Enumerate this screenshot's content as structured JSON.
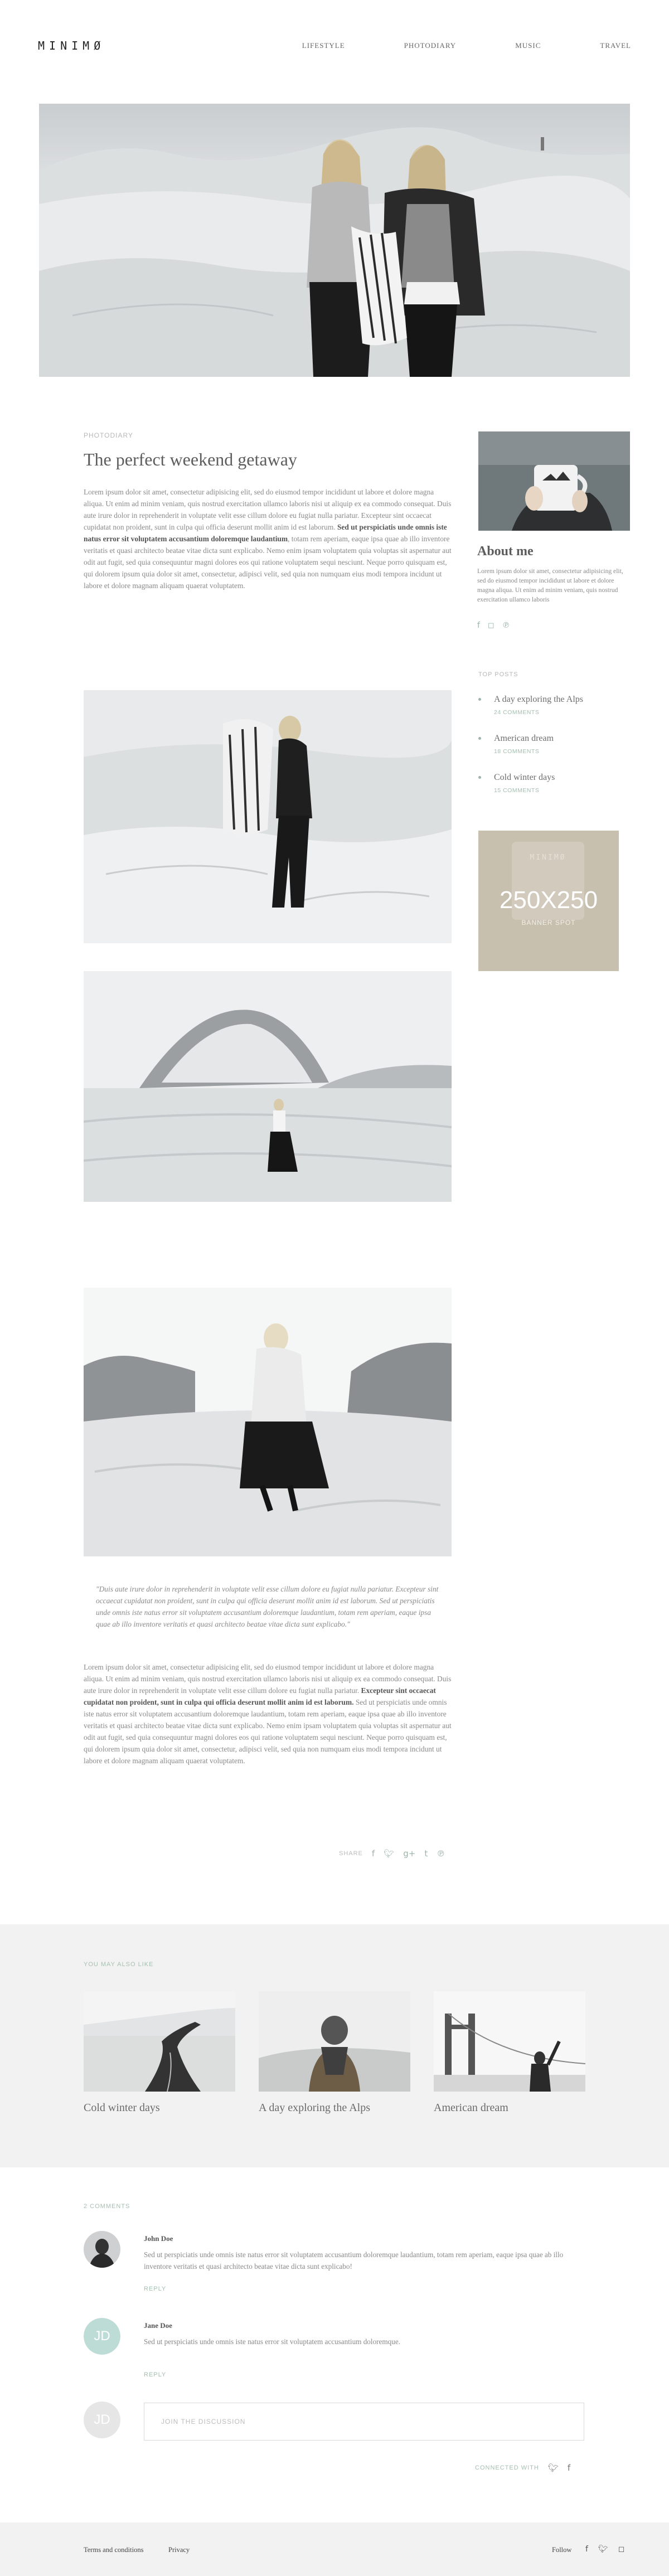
{
  "brand": {
    "logo": "MINIMØ"
  },
  "nav": {
    "items": [
      "LIFESTYLE",
      "PHOTODIARY",
      "MUSIC",
      "TRAVEL"
    ]
  },
  "article": {
    "category": "PHOTODIARY",
    "title": "The perfect weekend getaway",
    "intro_a": "Lorem ipsum dolor sit amet, consectetur adipisicing elit, sed do eiusmod tempor incididunt ut labore et dolore magna aliqua. Ut enim ad minim veniam, quis nostrud exercitation ullamco laboris nisi ut aliquip ex ea commodo consequat. Duis aute irure dolor in reprehenderit in voluptate velit esse cillum dolore eu fugiat nulla pariatur. Excepteur sint occaecat cupidatat non proident, sunt in culpa qui officia deserunt mollit anim id est laborum. ",
    "intro_bold": "Sed ut perspiciatis unde omnis iste natus error sit voluptatem accusantium doloremque laudantium",
    "intro_b": ", totam rem aperiam, eaque ipsa quae ab illo inventore veritatis et quasi architecto beatae vitae dicta sunt explicabo. Nemo enim ipsam voluptatem quia voluptas sit aspernatur aut odit aut fugit, sed quia consequuntur magni dolores eos qui ratione voluptatem sequi nesciunt. Neque porro quisquam est, qui dolorem ipsum quia dolor sit amet, consectetur, adipisci velit, sed quia non numquam eius modi tempora incidunt ut labore et dolore magnam aliquam quaerat voluptatem.",
    "quote": "\"Duis aute irure dolor in reprehenderit in voluptate velit esse cillum dolore eu fugiat nulla pariatur. Excepteur sint occaecat cupidatat non proident, sunt in culpa qui officia deserunt mollit anim id est laborum. Sed ut perspiciatis unde omnis iste natus error sit voluptatem accusantium doloremque laudantium, totam rem aperiam, eaque ipsa quae ab illo inventore veritatis et quasi architecto beatae vitae dicta sunt explicabo.\"",
    "outro_a": "Lorem ipsum dolor sit amet, consectetur adipisicing elit, sed do eiusmod tempor incididunt ut labore et dolore magna aliqua. Ut enim ad minim veniam, quis nostrud exercitation ullamco laboris nisi ut aliquip ex ea commodo consequat. Duis aute irure dolor in reprehenderit in voluptate velit esse cillum dolore eu fugiat nulla pariatur. ",
    "outro_bold": "Excepteur sint occaecat cupidatat non proident, sunt in culpa qui officia deserunt mollit anim id est laborum.",
    "outro_b": " Sed ut perspiciatis unde omnis iste natus error sit voluptatem accusantium doloremque laudantium, totam rem aperiam, eaque ipsa quae ab illo inventore veritatis et quasi architecto beatae vitae dicta sunt explicabo. Nemo enim ipsam voluptatem quia voluptas sit aspernatur aut odit aut fugit, sed quia consequuntur magni dolores eos qui ratione voluptatem sequi nesciunt. Neque porro quisquam est, qui dolorem ipsum quia dolor sit amet, consectetur, adipisci velit, sed quia non numquam eius modi tempora incidunt ut labore et dolore magnam aliquam quaerat voluptatem.",
    "share_label": "SHARE",
    "share_icons": [
      "facebook-icon",
      "twitter-icon",
      "google-plus-icon",
      "tumblr-icon",
      "pinterest-icon"
    ]
  },
  "sidebar": {
    "about_title": "About me",
    "about_text": "Lorem ipsum dolor sit amet, consectetur adipisicing elit, sed do eiusmod tempor incididunt ut labore et dolore magna aliqua. Ut enim ad minim veniam, quis nostrud exercitation ullamco laboris",
    "about_social": [
      "facebook-icon",
      "instagram-icon",
      "pinterest-icon"
    ],
    "top_posts_label": "TOP POSTS",
    "top_posts": [
      {
        "title": "A day exploring the Alps",
        "comments": "24 COMMENTS"
      },
      {
        "title": "American dream",
        "comments": "18 COMMENTS"
      },
      {
        "title": "Cold winter days",
        "comments": "15 COMMENTS"
      }
    ],
    "banner": {
      "size": "250X250",
      "label": "BANNER SPOT",
      "mug_logo": "MINIMØ"
    }
  },
  "related": {
    "label": "YOU MAY ALSO LIKE",
    "items": [
      {
        "title": "Cold winter days"
      },
      {
        "title": "A day exploring the Alps"
      },
      {
        "title": "American dream"
      }
    ]
  },
  "comments": {
    "label": "2 COMMENTS",
    "items": [
      {
        "name": "John Doe",
        "text": "Sed ut perspiciatis unde omnis iste natus error sit voluptatem accusantium doloremque laudantium, totam rem aperiam, eaque ipsa quae ab illo inventore veritatis et quasi architecto beatae vitae dicta sunt explicabo!",
        "reply": "REPLY",
        "avatar_initials": ""
      },
      {
        "name": "Jane Doe",
        "text": "Sed ut perspiciatis unde omnis iste natus error sit voluptatem accusantium doloremque.",
        "reply": "REPLY",
        "avatar_initials": "JD"
      }
    ],
    "join_avatar": "JD",
    "join_placeholder": "JOIN THE DISCUSSION",
    "connected_label": "CONNECTED WITH",
    "connected_icons": [
      "twitter-icon",
      "facebook-icon"
    ]
  },
  "footer": {
    "links": [
      "Terms and conditions",
      "Privacy"
    ],
    "follow_label": "Follow",
    "follow_icons": [
      "facebook-icon",
      "twitter-icon",
      "instagram-icon"
    ]
  },
  "colors": {
    "accent": "#9cb5a8",
    "text": "#8a8a8a",
    "heading": "#5d5d5d",
    "band": "#f2f2f2",
    "banner": "#c7bfae"
  }
}
